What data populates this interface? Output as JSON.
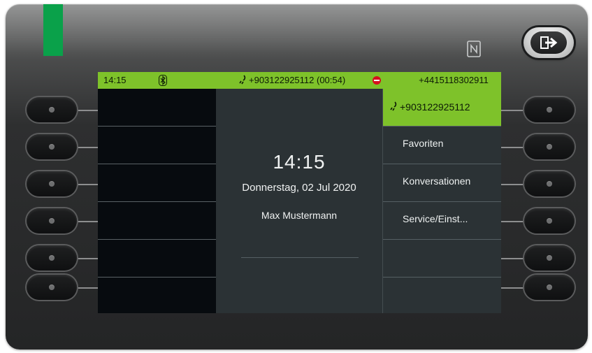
{
  "status_bar": {
    "time": "14:15",
    "active_call": "+903122925112 (00:54)",
    "own_number": "+4415118302911"
  },
  "idle": {
    "clock": "14:15",
    "date": "Donnerstag, 02 Jul 2020",
    "user_name": "Max Mustermann"
  },
  "menu": {
    "items": [
      {
        "label": "+903122925112",
        "icon": "call-icon",
        "active": true
      },
      {
        "label": "Favoriten"
      },
      {
        "label": "Konversationen"
      },
      {
        "label": "Service/Einst..."
      },
      {
        "label": ""
      },
      {
        "label": ""
      }
    ]
  },
  "colors": {
    "accent_green": "#7ec22a",
    "led_green": "#0aa14a",
    "block_red": "#d6101e",
    "screen_bg": "#2b3235"
  },
  "icons": {
    "nfc": "nfc-icon",
    "exit": "exit-icon",
    "bluetooth": "bluetooth-icon",
    "do_not_disturb": "do-not-disturb-icon"
  }
}
